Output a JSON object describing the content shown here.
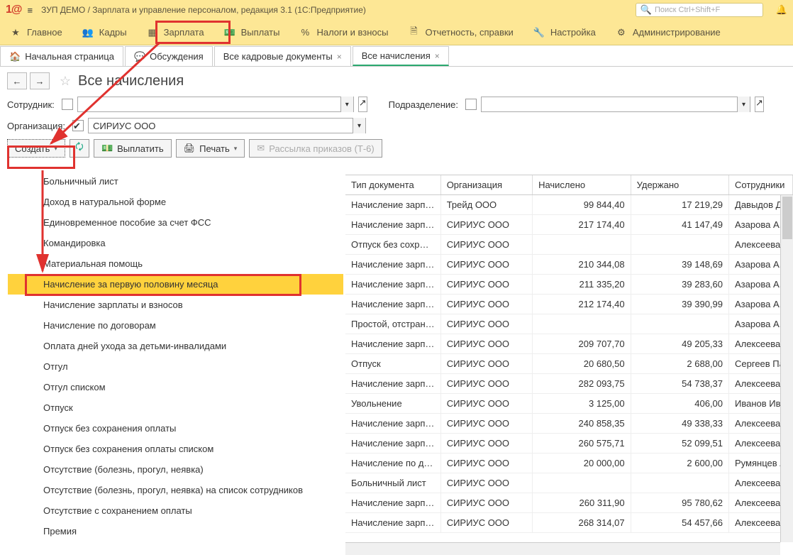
{
  "titlebar": {
    "app_title": "ЗУП ДЕМО / Зарплата и управление персоналом, редакция 3.1  (1С:Предприятие)",
    "search_placeholder": "Поиск Ctrl+Shift+F"
  },
  "mainnav": {
    "items": [
      {
        "label": "Главное"
      },
      {
        "label": "Кадры"
      },
      {
        "label": "Зарплата"
      },
      {
        "label": "Выплаты"
      },
      {
        "label": "Налоги и взносы"
      },
      {
        "label": "Отчетность, справки"
      },
      {
        "label": "Настройка"
      },
      {
        "label": "Администрирование"
      }
    ]
  },
  "tabs": [
    {
      "label": "Начальная страница",
      "closable": false
    },
    {
      "label": "Обсуждения",
      "closable": false
    },
    {
      "label": "Все кадровые документы",
      "closable": true
    },
    {
      "label": "Все начисления",
      "closable": true,
      "active": true
    }
  ],
  "page": {
    "title": "Все начисления"
  },
  "filters": {
    "employee_label": "Сотрудник:",
    "department_label": "Подразделение:",
    "org_label": "Организация:",
    "org_value": "СИРИУС ООО"
  },
  "toolbar": {
    "create": "Создать",
    "payout": "Выплатить",
    "print": "Печать",
    "mailing": "Рассылка приказов (Т-6)"
  },
  "dropdown": {
    "items": [
      "Больничный лист",
      "Доход в натуральной форме",
      "Единовременное пособие за счет ФСС",
      "Командировка",
      "Материальная помощь",
      "Начисление за первую половину месяца",
      "Начисление зарплаты и взносов",
      "Начисление по договорам",
      "Оплата дней ухода за детьми-инвалидами",
      "Отгул",
      "Отгул списком",
      "Отпуск",
      "Отпуск без сохранения оплаты",
      "Отпуск без сохранения оплаты списком",
      "Отсутствие (болезнь, прогул, неявка)",
      "Отсутствие (болезнь, прогул, неявка) на список сотрудников",
      "Отсутствие с сохранением оплаты",
      "Премия"
    ],
    "selected_index": 5
  },
  "table": {
    "headers": [
      "Тип документа",
      "Организация",
      "Начислено",
      "Удержано",
      "Сотрудники"
    ],
    "rows": [
      {
        "type": "Начисление зарп…",
        "org": "Трейд ООО",
        "accr": "99 844,40",
        "ded": "17 219,29",
        "emp": "Давыдов Д"
      },
      {
        "type": "Начисление зарп…",
        "org": "СИРИУС ООО",
        "accr": "217 174,40",
        "ded": "41 147,49",
        "emp": "Азарова А."
      },
      {
        "type": "Отпуск без сохр…",
        "org": "СИРИУС ООО",
        "accr": "",
        "ded": "",
        "emp": "Алексеева"
      },
      {
        "type": "Начисление зарп…",
        "org": "СИРИУС ООО",
        "accr": "210 344,08",
        "ded": "39 148,69",
        "emp": "Азарова А."
      },
      {
        "type": "Начисление зарп…",
        "org": "СИРИУС ООО",
        "accr": "211 335,20",
        "ded": "39 283,60",
        "emp": "Азарова А."
      },
      {
        "type": "Начисление зарп…",
        "org": "СИРИУС ООО",
        "accr": "212 174,40",
        "ded": "39 390,99",
        "emp": "Азарова А."
      },
      {
        "type": "Простой, отстран…",
        "org": "СИРИУС ООО",
        "accr": "",
        "ded": "",
        "emp": "Азарова А."
      },
      {
        "type": "Начисление зарп…",
        "org": "СИРИУС ООО",
        "accr": "209 707,70",
        "ded": "49 205,33",
        "emp": "Алексеева"
      },
      {
        "type": "Отпуск",
        "org": "СИРИУС ООО",
        "accr": "20 680,50",
        "ded": "2 688,00",
        "emp": "Сергеев Па"
      },
      {
        "type": "Начисление зарп…",
        "org": "СИРИУС ООО",
        "accr": "282 093,75",
        "ded": "54 738,37",
        "emp": "Алексеева"
      },
      {
        "type": "Увольнение",
        "org": "СИРИУС ООО",
        "accr": "3 125,00",
        "ded": "406,00",
        "emp": "Иванов Ив"
      },
      {
        "type": "Начисление зарп…",
        "org": "СИРИУС ООО",
        "accr": "240 858,35",
        "ded": "49 338,33",
        "emp": "Алексеева"
      },
      {
        "type": "Начисление зарп…",
        "org": "СИРИУС ООО",
        "accr": "260 575,71",
        "ded": "52 099,51",
        "emp": "Алексеева"
      },
      {
        "type": "Начисление по д…",
        "org": "СИРИУС ООО",
        "accr": "20 000,00",
        "ded": "2 600,00",
        "emp": "Румянцев А"
      },
      {
        "type": "Больничный лист",
        "org": "СИРИУС ООО",
        "accr": "",
        "ded": "",
        "emp": "Алексеева"
      },
      {
        "type": "Начисление зарп…",
        "org": "СИРИУС ООО",
        "accr": "260 311,90",
        "ded": "95 780,62",
        "emp": "Алексеева"
      },
      {
        "type": "Начисление зарп…",
        "org": "СИРИУС ООО",
        "accr": "268 314,07",
        "ded": "54 457,66",
        "emp": "Алексеева"
      }
    ]
  }
}
